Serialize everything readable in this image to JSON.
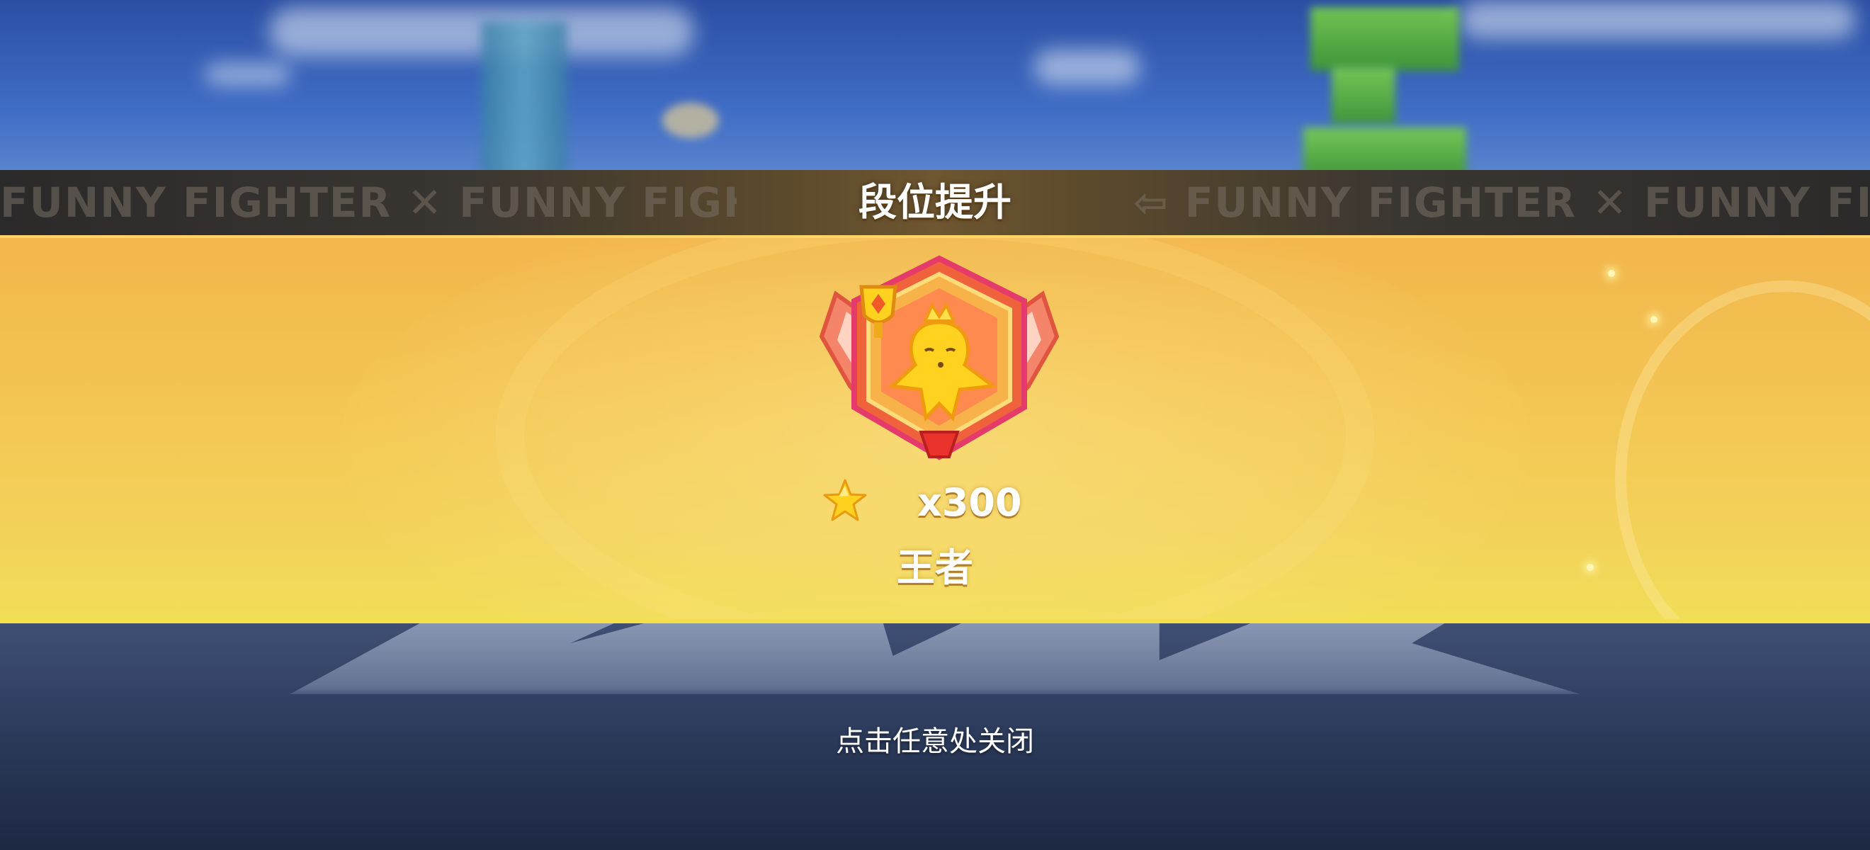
{
  "banner": {
    "title": "段位提升",
    "marquee_left": "FUNNY FIGHTER  ✕  FUNNY FIGHTER  ⇨",
    "marquee_right": "⇦  FUNNY FIGHTER  ✕  FUNNY FIGHTER"
  },
  "reward": {
    "icon": "star-icon",
    "amount": "x300"
  },
  "rank": {
    "name": "王者",
    "emblem_icon": "king-rank-emblem-icon"
  },
  "footer": {
    "close_hint": "点击任意处关闭"
  },
  "colors": {
    "panel_gold": "#f3c453",
    "panel_edge": "#f6e04a",
    "banner_dark": "#2b2a2a",
    "text_white": "#ffffff"
  }
}
